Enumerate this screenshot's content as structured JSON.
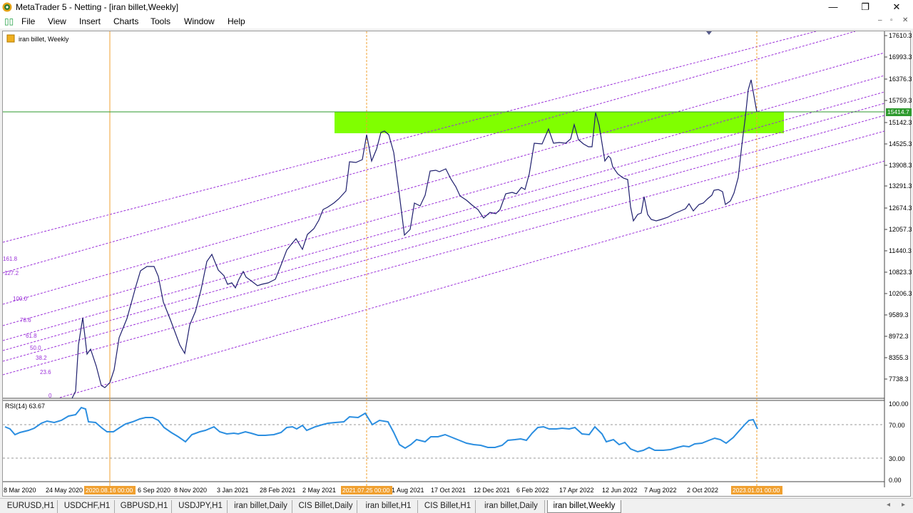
{
  "window": {
    "title": "MetaTrader 5 - Netting - [iran billet,Weekly]",
    "minimize": "—",
    "maximize": "❐",
    "close": "✕"
  },
  "menu": {
    "items": [
      "File",
      "View",
      "Insert",
      "Charts",
      "Tools",
      "Window",
      "Help"
    ],
    "mdi": [
      "–",
      "▫",
      "✕"
    ]
  },
  "chart": {
    "label": "iran billet, Weekly",
    "icon": "chart-window-icon",
    "price_axis": [
      "17610.3",
      "16993.3",
      "16376.3",
      "15759.3",
      "15142.3",
      "14525.3",
      "13908.3",
      "13291.3",
      "12674.3",
      "12057.3",
      "11440.3",
      "10823.3",
      "10206.3",
      "9589.3",
      "8972.3",
      "8355.3",
      "7738.3"
    ],
    "current_price": "15414.7",
    "fib_levels": [
      "161.8",
      "127.2",
      "100.0",
      "78.6",
      "61.8",
      "50.0",
      "38.2",
      "23.6",
      "0"
    ],
    "date_axis": [
      "8 Mar 2020",
      "24 May 2020",
      "6 Sep 2020",
      "8 Nov 2020",
      "3 Jan 2021",
      "28 Feb 2021",
      "2 May 2021",
      "1 Aug 2021",
      "17 Oct 2021",
      "12 Dec 2021",
      "6 Feb 2022",
      "17 Apr 2022",
      "12 Jun 2022",
      "7 Aug 2022",
      "2 Oct 2022"
    ],
    "highlight_dates": [
      "2020.08.16 00:00",
      "2021.07.25 00:00",
      "2023.01.01 00:00"
    ],
    "colors": {
      "price_line": "#1f1f6e",
      "zone": "#80ff00",
      "fib": "#9b30d9",
      "vline": "#f0a030",
      "hline": "#2e9a2e",
      "rsi": "#2b8ee0"
    }
  },
  "rsi": {
    "label": "RSI(14) 63.67",
    "axis": [
      "100.00",
      "70.00",
      "30.00",
      "0.00"
    ]
  },
  "tabs": [
    {
      "label": "EURUSD,H1",
      "active": false
    },
    {
      "label": "USDCHF,H1",
      "active": false
    },
    {
      "label": "GBPUSD,H1",
      "active": false
    },
    {
      "label": "USDJPY,H1",
      "active": false
    },
    {
      "label": "iran billet,Daily",
      "active": false
    },
    {
      "label": "CIS Billet,Daily",
      "active": false
    },
    {
      "label": "iran billet,H1",
      "active": false
    },
    {
      "label": "CIS Billet,H1",
      "active": false
    },
    {
      "label": "iran billet,Daily",
      "active": false
    },
    {
      "label": "iran billet,Weekly",
      "active": true
    }
  ],
  "tab_scroll": [
    "◂",
    "▸"
  ]
}
